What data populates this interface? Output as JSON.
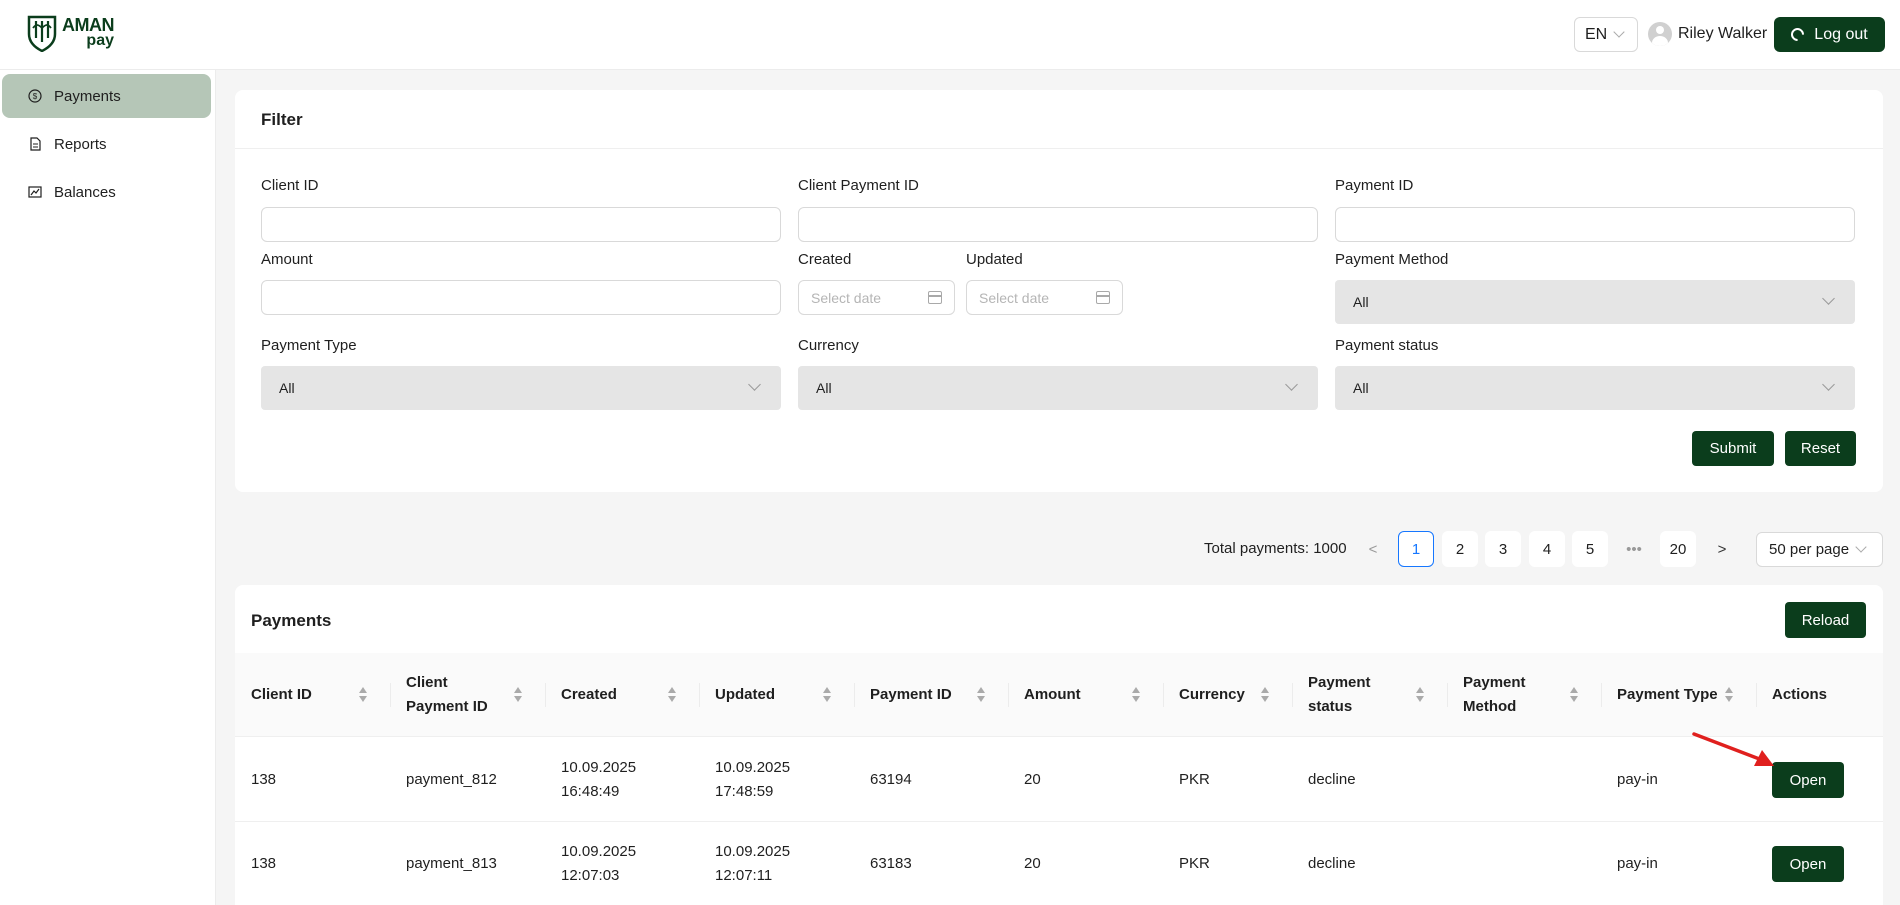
{
  "header": {
    "logo_line1": "AMAN",
    "logo_line2": "pay",
    "language": "EN",
    "user_name": "Riley Walker",
    "logout_label": "Log out"
  },
  "sidebar": {
    "items": [
      {
        "label": "Payments",
        "icon": "dollar-circle-icon",
        "active": true
      },
      {
        "label": "Reports",
        "icon": "file-icon",
        "active": false
      },
      {
        "label": "Balances",
        "icon": "chart-icon",
        "active": false
      }
    ]
  },
  "filter": {
    "title": "Filter",
    "client_id_label": "Client ID",
    "client_payment_id_label": "Client Payment ID",
    "payment_id_label": "Payment ID",
    "amount_label": "Amount",
    "created_label": "Created",
    "updated_label": "Updated",
    "created_placeholder": "Select date",
    "updated_placeholder": "Select date",
    "payment_method_label": "Payment Method",
    "payment_method_value": "All",
    "payment_type_label": "Payment Type",
    "payment_type_value": "All",
    "currency_label": "Currency",
    "currency_value": "All",
    "payment_status_label": "Payment status",
    "payment_status_value": "All",
    "submit_label": "Submit",
    "reset_label": "Reset"
  },
  "pagination": {
    "total": "Total payments: 1000",
    "pages": [
      "1",
      "2",
      "3",
      "4",
      "5",
      "20"
    ],
    "ellipsis": "•••",
    "prev": "<",
    "next": ">",
    "current": "1",
    "per_page": "50 per page"
  },
  "payments": {
    "title": "Payments",
    "reload_label": "Reload",
    "columns": [
      "Client ID",
      "Client\nPayment ID",
      "Created",
      "Updated",
      "Payment ID",
      "Amount",
      "Currency",
      "Payment\nstatus",
      "Payment\nMethod",
      "Payment Type",
      "Actions"
    ],
    "rows": [
      {
        "client_id": "138",
        "client_payment_id": "payment_812",
        "created_date": "10.09.2025",
        "created_time": "16:48:49",
        "updated_date": "10.09.2025",
        "updated_time": "17:48:59",
        "payment_id": "63194",
        "amount": "20",
        "currency": "PKR",
        "status": "decline",
        "method": "",
        "type": "pay-in",
        "action": "Open"
      },
      {
        "client_id": "138",
        "client_payment_id": "payment_813",
        "created_date": "10.09.2025",
        "created_time": "12:07:03",
        "updated_date": "10.09.2025",
        "updated_time": "12:07:11",
        "payment_id": "63183",
        "amount": "20",
        "currency": "PKR",
        "status": "decline",
        "method": "",
        "type": "pay-in",
        "action": "Open"
      }
    ]
  },
  "colors": {
    "brand_green": "#0b3d1c",
    "sidebar_active": "#b5c6b7",
    "pagination_active": "#1677ff",
    "annotation_arrow": "#e0201e"
  }
}
